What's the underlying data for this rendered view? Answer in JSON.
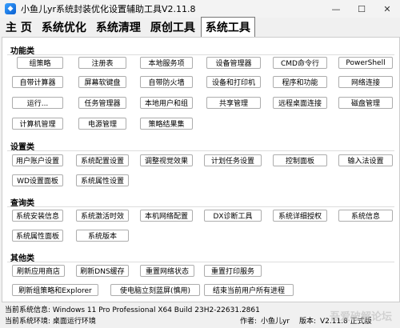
{
  "window": {
    "title": "小鱼儿yr系统封装优化设置辅助工具V2.11.8",
    "icon": "fish-icon",
    "controls": [
      "—",
      "☐",
      "✕"
    ]
  },
  "tabs": [
    "主 页",
    "系统优化",
    "系统清理",
    "原创工具",
    "系统工具"
  ],
  "active_tab": "系统工具",
  "sections": {
    "function": {
      "title": "功能类",
      "rows": [
        [
          "组策略",
          "注册表",
          "本地服务项",
          "设备管理器",
          "CMD命令行",
          "PowerShell"
        ],
        [
          "自带计算器",
          "屏幕软键盘",
          "自带防火墙",
          "设备和打印机",
          "程序和功能",
          "网络连接"
        ],
        [
          "运行...",
          "任务管理器",
          "本地用户和组",
          "共享管理",
          "远程桌面连接",
          "磁盘管理"
        ],
        [
          "计算机管理",
          "电源管理",
          "策略结果集"
        ]
      ]
    },
    "settings": {
      "title": "设置类",
      "rows": [
        [
          "用户账户设置",
          "系统配置设置",
          "调整视觉效果",
          "计划任务设置",
          "控制面板",
          "输入法设置"
        ],
        [
          "WD设置面板",
          "系统属性设置"
        ]
      ]
    },
    "query": {
      "title": "查询类",
      "rows": [
        [
          "系统安装信息",
          "系统激活时效",
          "本机网络配置",
          "DX诊断工具",
          "系统详细授权",
          "系统信息"
        ],
        [
          "系统属性面板",
          "系统版本"
        ]
      ]
    },
    "other": {
      "title": "其他类",
      "rows": [
        [
          "刷新应用商店",
          "刷新DNS缓存",
          "重置网络状态",
          "重置打印服务"
        ],
        [
          "刷新组策略和Explorer",
          "使电脑立刻蓝屏(慎用)",
          "结束当前用户所有进程"
        ]
      ]
    }
  },
  "status": {
    "line1": "当前系统信息: Windows 11 Pro Professional X64 Build 23H2-22631.2861",
    "line2": "当前系统环境: 桌面运行环境",
    "author_label": "作者:",
    "author": "小鱼儿yr",
    "version_label": "版本:",
    "version": "V2.11.8 正式版"
  },
  "watermark": "吾爱破解论坛"
}
